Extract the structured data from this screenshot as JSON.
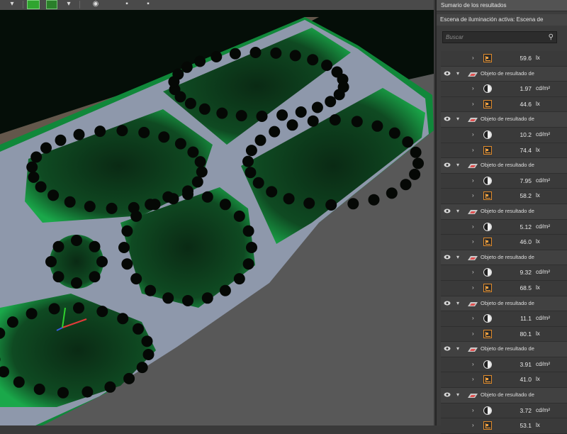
{
  "toolbar": {
    "icons": [
      "color-green-button",
      "color-green-light-button",
      "camera-icon",
      "grid-icon"
    ]
  },
  "panel": {
    "title": "Sumario de los resultados",
    "scene_label": "Escena de iluminación activa: Escena de",
    "search_placeholder": "Buscar",
    "rows": [
      {
        "type": "illuminance",
        "value": "59.6",
        "unit": "lx"
      },
      {
        "type": "group",
        "label": "Objeto de resultado de"
      },
      {
        "type": "luminance",
        "value": "1.97",
        "unit": "cd/m²"
      },
      {
        "type": "illuminance",
        "value": "44.6",
        "unit": "lx"
      },
      {
        "type": "group",
        "label": "Objeto de resultado de"
      },
      {
        "type": "luminance",
        "value": "10.2",
        "unit": "cd/m²"
      },
      {
        "type": "illuminance",
        "value": "74.4",
        "unit": "lx"
      },
      {
        "type": "group",
        "label": "Objeto de resultado de"
      },
      {
        "type": "luminance",
        "value": "7.95",
        "unit": "cd/m²"
      },
      {
        "type": "illuminance",
        "value": "58.2",
        "unit": "lx"
      },
      {
        "type": "group",
        "label": "Objeto de resultado de"
      },
      {
        "type": "luminance",
        "value": "5.12",
        "unit": "cd/m²"
      },
      {
        "type": "illuminance",
        "value": "46.0",
        "unit": "lx"
      },
      {
        "type": "group",
        "label": "Objeto de resultado de"
      },
      {
        "type": "luminance",
        "value": "9.32",
        "unit": "cd/m²"
      },
      {
        "type": "illuminance",
        "value": "68.5",
        "unit": "lx"
      },
      {
        "type": "group",
        "label": "Objeto de resultado de"
      },
      {
        "type": "luminance",
        "value": "11.1",
        "unit": "cd/m²"
      },
      {
        "type": "illuminance",
        "value": "80.1",
        "unit": "lx"
      },
      {
        "type": "group",
        "label": "Objeto de resultado de"
      },
      {
        "type": "luminance",
        "value": "3.91",
        "unit": "cd/m²"
      },
      {
        "type": "illuminance",
        "value": "41.0",
        "unit": "lx"
      },
      {
        "type": "group",
        "label": "Objeto de resultado de"
      },
      {
        "type": "luminance",
        "value": "3.72",
        "unit": "cd/m²"
      },
      {
        "type": "illuminance",
        "value": "53.1",
        "unit": "lx"
      }
    ]
  },
  "colors": {
    "accent_green": "#1fa84a",
    "lawn": "#0d5a24",
    "path": "#8a93a6",
    "orange_icon": "#e08a2a"
  }
}
